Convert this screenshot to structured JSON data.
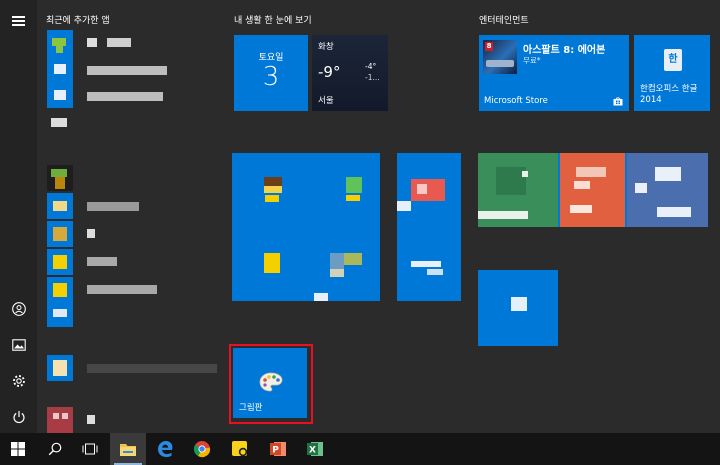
{
  "groups": {
    "recent_apps": "최근에 추가한 앱",
    "my_life": "내 생활 한 눈에 보기",
    "entertainment": "엔터테인먼트"
  },
  "calendar": {
    "day": "토요일",
    "date": "3"
  },
  "weather": {
    "condition": "화창",
    "temp": "-9°",
    "high": "-4°",
    "low": "-1...",
    "city": "서울"
  },
  "asphalt": {
    "title": "아스팔트 8: 에어본",
    "price": "무료*",
    "store": "Microsoft Store",
    "badge": "8"
  },
  "hancom": {
    "label": "한컴오피스 한글 2014",
    "glyph": "한"
  },
  "paint": {
    "label": "그림판"
  },
  "colors": {
    "tile_blue": "#0078d7",
    "highlight": "#e81123",
    "green_tile": "#3a8e5a",
    "orange_tile": "#e06040",
    "navy_tile": "#4b6eaf"
  },
  "icons": [
    "hamburger-icon",
    "user-icon",
    "pictures-icon",
    "settings-icon",
    "power-icon",
    "windows-icon",
    "search-icon",
    "task-view-icon",
    "file-explorer-icon",
    "edge-icon",
    "chrome-icon",
    "sticky-notes-icon",
    "powerpoint-icon",
    "excel-icon"
  ]
}
